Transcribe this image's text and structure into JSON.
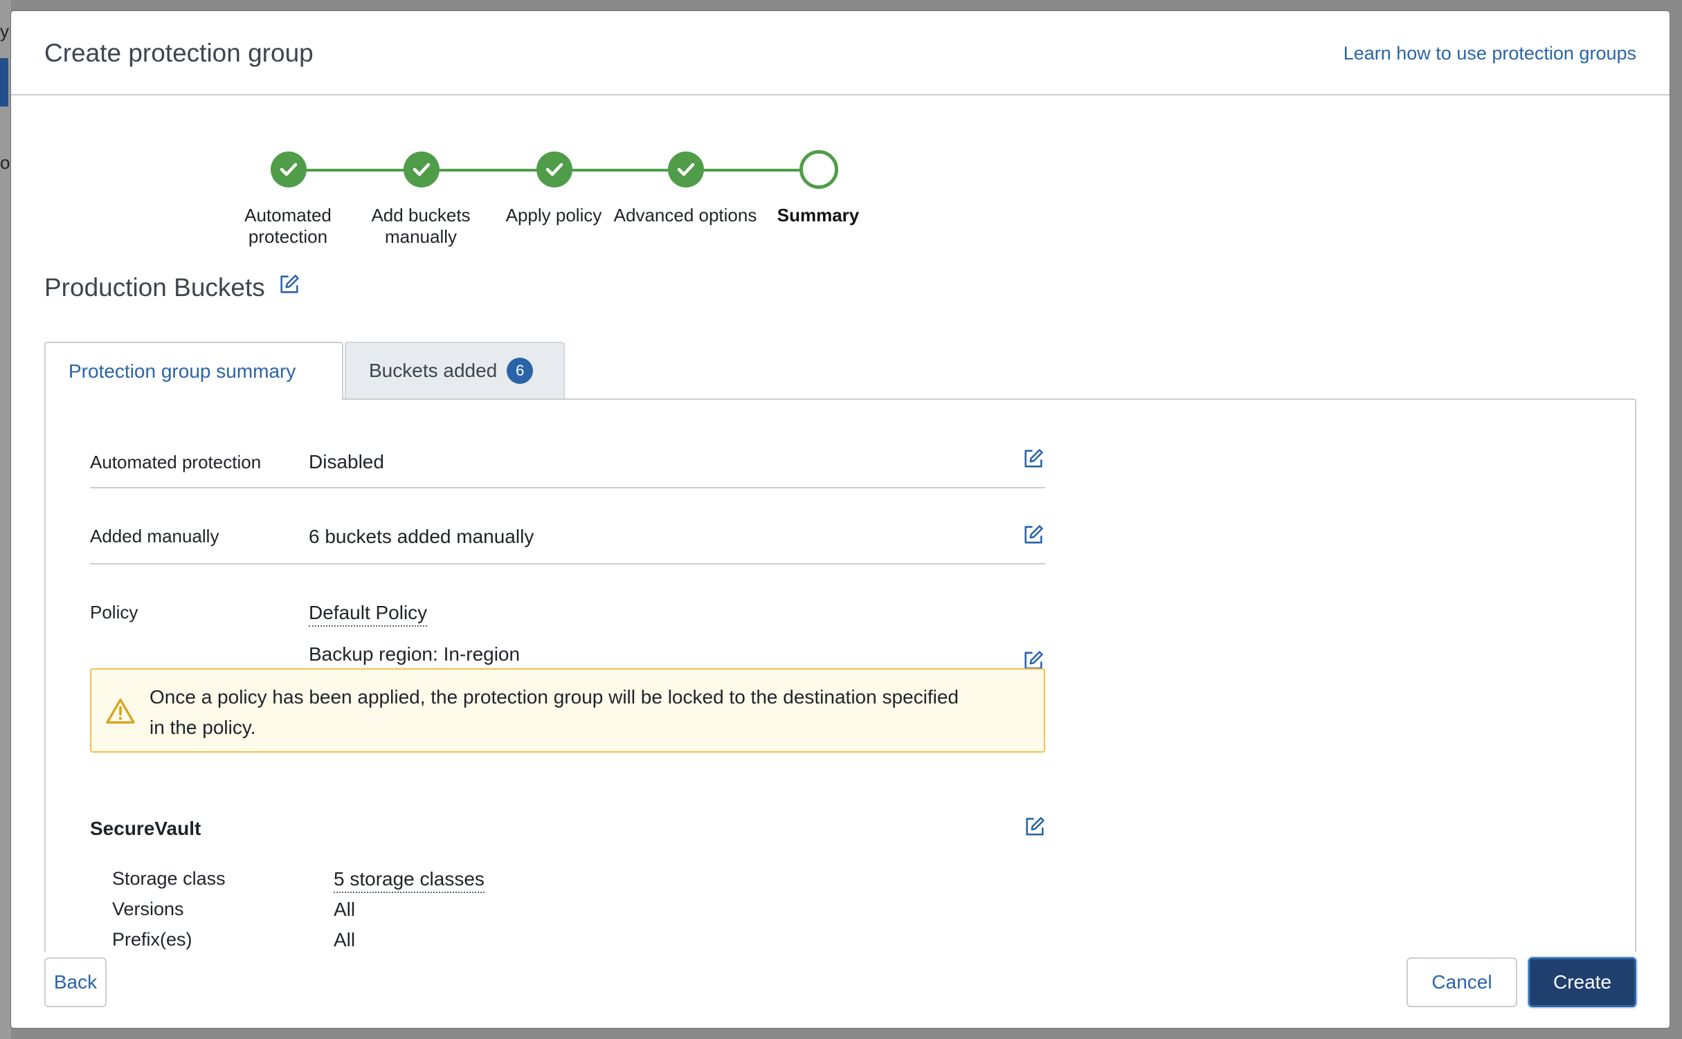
{
  "backdrop": {
    "peek_a": "y",
    "peek_b": "ot"
  },
  "header": {
    "title": "Create protection group",
    "help_link": "Learn how to use protection groups"
  },
  "stepper": {
    "steps": [
      {
        "label_line1": "Automated",
        "label_line2": "protection",
        "state": "complete"
      },
      {
        "label_line1": "Add buckets",
        "label_line2": "manually",
        "state": "complete"
      },
      {
        "label_line1": "Apply policy",
        "label_line2": "",
        "state": "complete"
      },
      {
        "label_line1": "Advanced options",
        "label_line2": "",
        "state": "complete"
      },
      {
        "label_line1": "Summary",
        "label_line2": "",
        "state": "current"
      }
    ]
  },
  "group": {
    "name": "Production Buckets"
  },
  "tabs": [
    {
      "label": "Protection group summary",
      "active": true
    },
    {
      "label": "Buckets added",
      "badge": "6",
      "active": false
    }
  ],
  "summary": {
    "automated": {
      "label": "Automated protection",
      "value": "Disabled"
    },
    "manual": {
      "label": "Added manually",
      "value": "6 buckets added manually"
    },
    "policy": {
      "label": "Policy",
      "value": "Default Policy",
      "region": "Backup region: In-region",
      "warning_line1": "Once a policy has been applied, the protection group will be locked to the destination specified",
      "warning_line2": "in the policy."
    },
    "securevault": {
      "title": "SecureVault",
      "storage_class_label": "Storage class",
      "storage_class_value": "5 storage classes",
      "versions_label": "Versions",
      "versions_value": "All",
      "prefix_label": "Prefix(es)",
      "prefix_value": "All"
    }
  },
  "footer": {
    "back": "Back",
    "cancel": "Cancel",
    "create": "Create"
  },
  "colors": {
    "accent": "#2a64a8",
    "success": "#4f9d49",
    "warning_border": "#efc24e",
    "primary_button": "#1f3f6e"
  }
}
